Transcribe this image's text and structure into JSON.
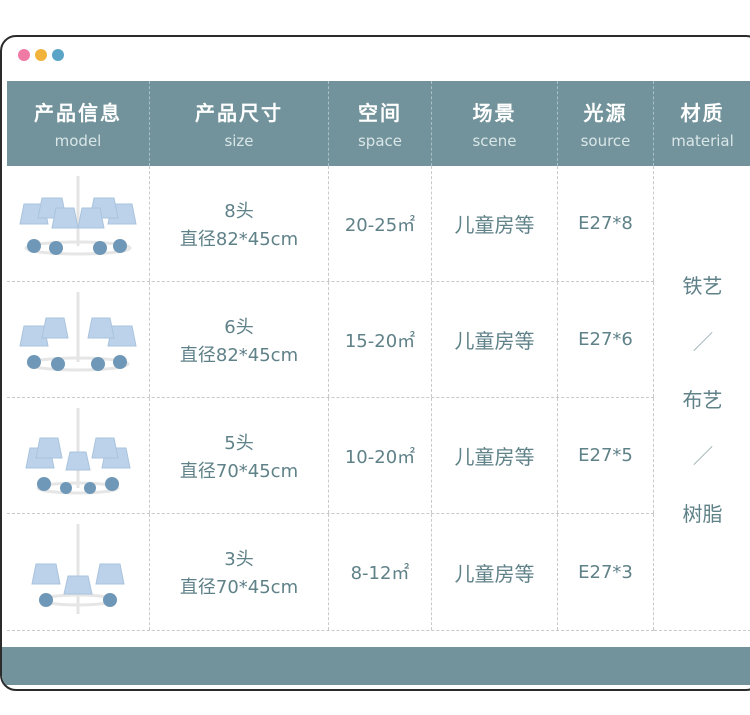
{
  "window_dots": [
    {
      "name": "pink",
      "color": "#ef7aa4"
    },
    {
      "name": "yellow",
      "color": "#f2b33d"
    },
    {
      "name": "blue",
      "color": "#5aa4c8"
    }
  ],
  "colors": {
    "header_bg": "#72939b",
    "text": "#5f8188",
    "accent_blue": "#8fb3d5"
  },
  "headers": [
    {
      "zh": "产品信息",
      "en": "model"
    },
    {
      "zh": "产品尺寸",
      "en": "size"
    },
    {
      "zh": "空间",
      "en": "space"
    },
    {
      "zh": "场景",
      "en": "scene"
    },
    {
      "zh": "光源",
      "en": "source"
    },
    {
      "zh": "材质",
      "en": "material"
    }
  ],
  "rows": [
    {
      "heads": "8头",
      "dim": "直径82*45cm",
      "space": "20-25㎡",
      "scene": "儿童房等",
      "source": "E27*8"
    },
    {
      "heads": "6头",
      "dim": "直径82*45cm",
      "space": "15-20㎡",
      "scene": "儿童房等",
      "source": "E27*6"
    },
    {
      "heads": "5头",
      "dim": "直径70*45cm",
      "space": "10-20㎡",
      "scene": "儿童房等",
      "source": "E27*5"
    },
    {
      "heads": "3头",
      "dim": "直径70*45cm",
      "space": "8-12㎡",
      "scene": "儿童房等",
      "source": "E27*3"
    }
  ],
  "material": {
    "m1": "铁艺",
    "m2": "布艺",
    "m3": "树脂"
  }
}
